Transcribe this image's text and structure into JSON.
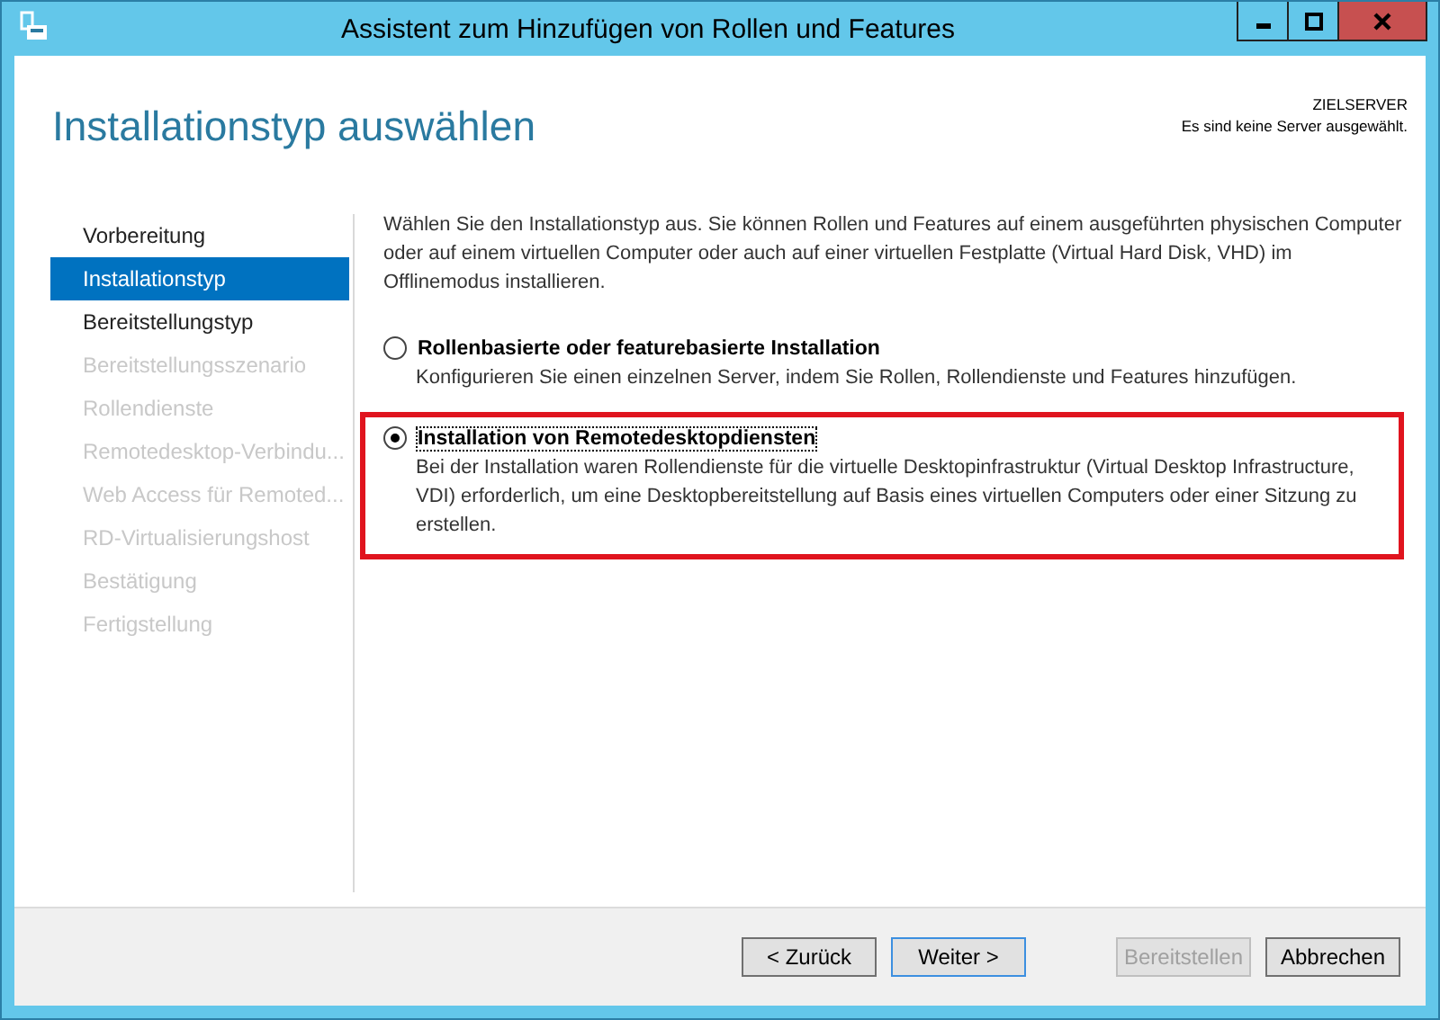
{
  "window": {
    "title": "Assistent zum Hinzufügen von Rollen und Features"
  },
  "header": {
    "title": "Installationstyp auswählen",
    "target_label": "ZIELSERVER",
    "target_value": "Es sind keine Server ausgewählt."
  },
  "steps": [
    {
      "label": "Vorbereitung",
      "selected": false,
      "disabled": false
    },
    {
      "label": "Installationstyp",
      "selected": true,
      "disabled": false
    },
    {
      "label": "Bereitstellungstyp",
      "selected": false,
      "disabled": false
    },
    {
      "label": "Bereitstellungsszenario",
      "selected": false,
      "disabled": true
    },
    {
      "label": "Rollendienste",
      "selected": false,
      "disabled": true
    },
    {
      "label": "Remotedesktop-Verbindu...",
      "selected": false,
      "disabled": true
    },
    {
      "label": "Web Access für Remoted...",
      "selected": false,
      "disabled": true
    },
    {
      "label": "RD-Virtualisierungshost",
      "selected": false,
      "disabled": true
    },
    {
      "label": "Bestätigung",
      "selected": false,
      "disabled": true
    },
    {
      "label": "Fertigstellung",
      "selected": false,
      "disabled": true
    }
  ],
  "intro": "Wählen Sie den Installationstyp aus. Sie können Rollen und Features auf einem ausgeführten physischen Computer oder auf einem virtuellen Computer oder auch auf einer virtuellen Festplatte (Virtual Hard Disk, VHD) im Offlinemodus installieren.",
  "options": [
    {
      "label": "Rollenbasierte oder featurebasierte Installation",
      "description": "Konfigurieren Sie einen einzelnen Server, indem Sie Rollen, Rollendienste und Features hinzufügen.",
      "selected": false,
      "highlighted": false
    },
    {
      "label": "Installation von Remotedesktopdiensten",
      "description": "Bei der Installation waren Rollendienste für die virtuelle Desktopinfrastruktur (Virtual Desktop Infrastructure, VDI) erforderlich, um eine Desktopbereitstellung auf Basis eines virtuellen Computers oder einer Sitzung zu erstellen.",
      "selected": true,
      "highlighted": true
    }
  ],
  "buttons": [
    {
      "label": "< Zurück",
      "disabled": false,
      "focused": false
    },
    {
      "label": "Weiter >",
      "disabled": false,
      "focused": true
    },
    {
      "label": "Bereitstellen",
      "disabled": true,
      "focused": false
    },
    {
      "label": "Abbrechen",
      "disabled": false,
      "focused": false
    }
  ]
}
